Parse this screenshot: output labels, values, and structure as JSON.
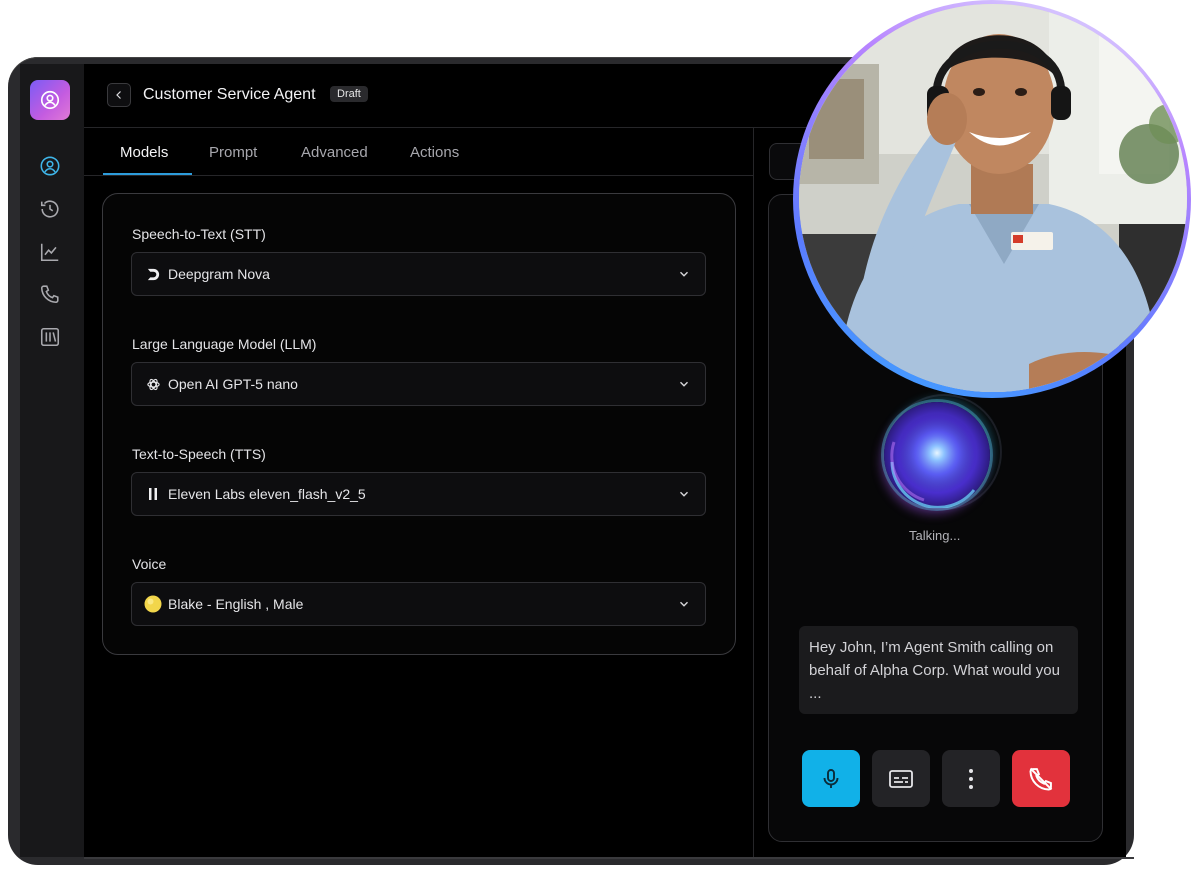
{
  "header": {
    "title": "Customer Service Agent",
    "badge": "Draft"
  },
  "tabs": [
    {
      "label": "Models",
      "active": true
    },
    {
      "label": "Prompt",
      "active": false
    },
    {
      "label": "Advanced",
      "active": false
    },
    {
      "label": "Actions",
      "active": false
    }
  ],
  "sidebar": {
    "icons": [
      "agent-icon",
      "history-icon",
      "analytics-icon",
      "phone-icon",
      "library-icon"
    ]
  },
  "models": {
    "stt": {
      "label": "Speech-to-Text (STT)",
      "value": "Deepgram Nova",
      "icon": "deepgram-logo-icon"
    },
    "llm": {
      "label": "Large Language Model (LLM)",
      "value": "Open AI GPT-5 nano",
      "icon": "openai-logo-icon"
    },
    "tts": {
      "label": "Text-to-Speech (TTS)",
      "value": "Eleven Labs eleven_flash_v2_5",
      "icon": "elevenlabs-logo-icon"
    },
    "voice": {
      "label": "Voice",
      "value": "Blake - English , Male",
      "icon": "voice-avatar-icon"
    }
  },
  "call": {
    "status": "Talking...",
    "transcript": "Hey John, I’m Agent Smith calling on behalf of Alpha Corp. What would you ...",
    "controls": [
      "microphone-icon",
      "captions-icon",
      "more-vertical-icon",
      "hang-up-icon"
    ]
  },
  "colors": {
    "accent": "#2d9cdb",
    "mic_active": "#11b1e8",
    "hang_up": "#e2323c",
    "voice_avatar": "#f2d64b"
  }
}
